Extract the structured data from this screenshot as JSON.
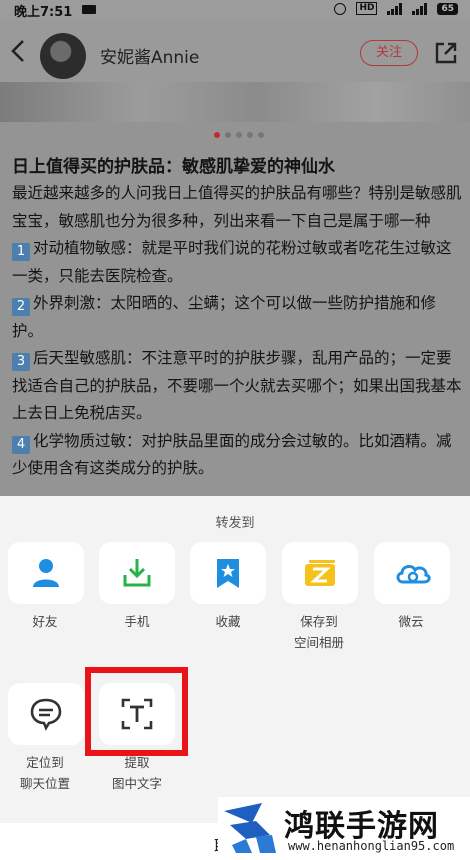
{
  "status_bar": {
    "time": "晚上7:51",
    "box_label": "HD",
    "battery": "65"
  },
  "header": {
    "username": "安妮酱Annie",
    "follow_label": "关注"
  },
  "article": {
    "title": "日上值得买的护肤品：敏感肌挚爱的神仙水",
    "intro": "最近越来越多的人问我日上值得买的护肤品有哪些？特别是敏感肌宝宝，敏感肌也分为很多种，列出来看一下自己是属于哪一种",
    "items": [
      {
        "num": "1",
        "text": "对动植物敏感：就是平时我们说的花粉过敏或者吃花生过敏这一类，只能去医院检查。"
      },
      {
        "num": "2",
        "text": "外界刺激：太阳晒的、尘螨；这个可以做一些防护措施和修护。"
      },
      {
        "num": "3",
        "text": "后天型敏感肌：不注意平时的护肤步骤，乱用产品的；一定要找适合自己的护肤品，不要哪一个火就去买哪个；如果出国我基本上去日上免税店买。"
      },
      {
        "num": "4",
        "text": "化学物质过敏：对护肤品里面的成分会过敏的。比如酒精。减少使用含有这类成分的护肤。"
      }
    ]
  },
  "sheet": {
    "title": "转发到",
    "row1": [
      {
        "label": "好友",
        "icon": "person-icon",
        "color": "#1e8fe0"
      },
      {
        "label": "手机",
        "icon": "download-phone-icon",
        "color": "#27b34a"
      },
      {
        "label": "收藏",
        "icon": "bookmark-star-icon",
        "color": "#1e8fe0"
      },
      {
        "label": "保存到\n空间相册",
        "icon": "album-icon",
        "color": "#f4c21a"
      },
      {
        "label": "微云",
        "icon": "cloud-icon",
        "color": "#1e8fe0"
      }
    ],
    "row2": [
      {
        "label": "定位到\n聊天位置",
        "icon": "chat-bubble-icon",
        "color": "#333333"
      },
      {
        "label": "提取\n图中文字",
        "icon": "text-scan-icon",
        "color": "#333333"
      }
    ]
  },
  "bottom_fragment": "取",
  "watermark": {
    "name": "鸿联手游网",
    "url": "www.henanhonglian95.com"
  },
  "colors": {
    "accent_red": "#e8141a",
    "follow_red": "#b03a3a"
  }
}
